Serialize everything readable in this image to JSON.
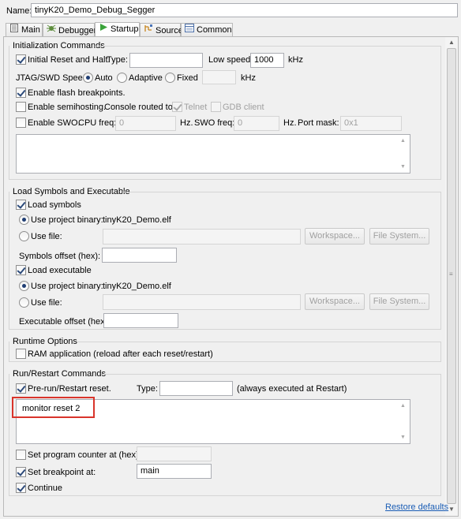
{
  "name_row": {
    "label": "Name:",
    "value": "tinyK20_Demo_Debug_Segger"
  },
  "tabs": [
    {
      "label": "Main",
      "icon": "main-icon"
    },
    {
      "label": "Debugger",
      "icon": "debugger-icon"
    },
    {
      "label": "Startup",
      "icon": "startup-icon"
    },
    {
      "label": "Source",
      "icon": "source-icon"
    },
    {
      "label": "Common",
      "icon": "common-icon"
    }
  ],
  "active_tab": "Startup",
  "init": {
    "title": "Initialization Commands",
    "initial_reset_label": "Initial Reset and Halt.",
    "initial_reset_checked": true,
    "type_label": "Type:",
    "type_value": "",
    "low_speed_label": "Low speed:",
    "low_speed_value": "1000",
    "khz": "kHz",
    "jtag_label": "JTAG/SWD Speed:",
    "speed_auto": "Auto",
    "speed_adaptive": "Adaptive",
    "speed_fixed": "Fixed",
    "speed_selected": "Auto",
    "fixed_value": "",
    "jtag_khz": "kHz",
    "flash_bp_label": "Enable flash breakpoints.",
    "flash_bp_checked": true,
    "semihosting_label": "Enable semihosting.",
    "semihosting_checked": false,
    "console_routed_label": "Console routed to:",
    "telnet_label": "Telnet",
    "telnet_checked": true,
    "gdb_client_label": "GDB client",
    "gdb_client_checked": false,
    "swo_label": "Enable SWO.",
    "swo_checked": false,
    "cpu_freq_label": "CPU freq:",
    "cpu_freq_value": "0",
    "hz1": "Hz.",
    "swo_freq_label": "SWO freq:",
    "swo_freq_value": "0",
    "hz2": "Hz.",
    "port_mask_label": "Port mask:",
    "port_mask_value": "0x1",
    "commands_text": ""
  },
  "load": {
    "title": "Load Symbols and Executable",
    "load_symbols_label": "Load symbols",
    "load_symbols_checked": true,
    "use_project_binary_label": "Use project binary:",
    "symbols_binary": "tinyK20_Demo.elf",
    "use_file_label": "Use file:",
    "symbols_file_value": "",
    "workspace_label": "Workspace...",
    "file_system_label": "File System...",
    "symbols_offset_label": "Symbols offset (hex):",
    "symbols_offset_value": "",
    "load_executable_label": "Load executable",
    "load_executable_checked": true,
    "exec_use_project_binary_label": "Use project binary:",
    "exec_binary": "tinyK20_Demo.elf",
    "exec_use_file_label": "Use file:",
    "exec_file_value": "",
    "exec_workspace_label": "Workspace...",
    "exec_file_system_label": "File System...",
    "exec_offset_label": "Executable offset (hex):",
    "exec_offset_value": ""
  },
  "runtime": {
    "title": "Runtime Options",
    "ram_app_label": "RAM application (reload after each reset/restart)",
    "ram_app_checked": false
  },
  "restart": {
    "title": "Run/Restart Commands",
    "prerun_label": "Pre-run/Restart reset.",
    "prerun_checked": true,
    "type_label": "Type:",
    "type_value": "",
    "always_note": "(always executed at Restart)",
    "commands_text": "monitor reset 2",
    "set_pc_label": "Set program counter at (hex):",
    "set_pc_checked": false,
    "set_pc_value": "",
    "set_bp_label": "Set breakpoint at:",
    "set_bp_checked": true,
    "set_bp_value": "main",
    "continue_label": "Continue",
    "continue_checked": true
  },
  "restore_defaults_label": "Restore defaults",
  "colors": {
    "highlight_box": "#d9342b",
    "link": "#1a5db5"
  }
}
